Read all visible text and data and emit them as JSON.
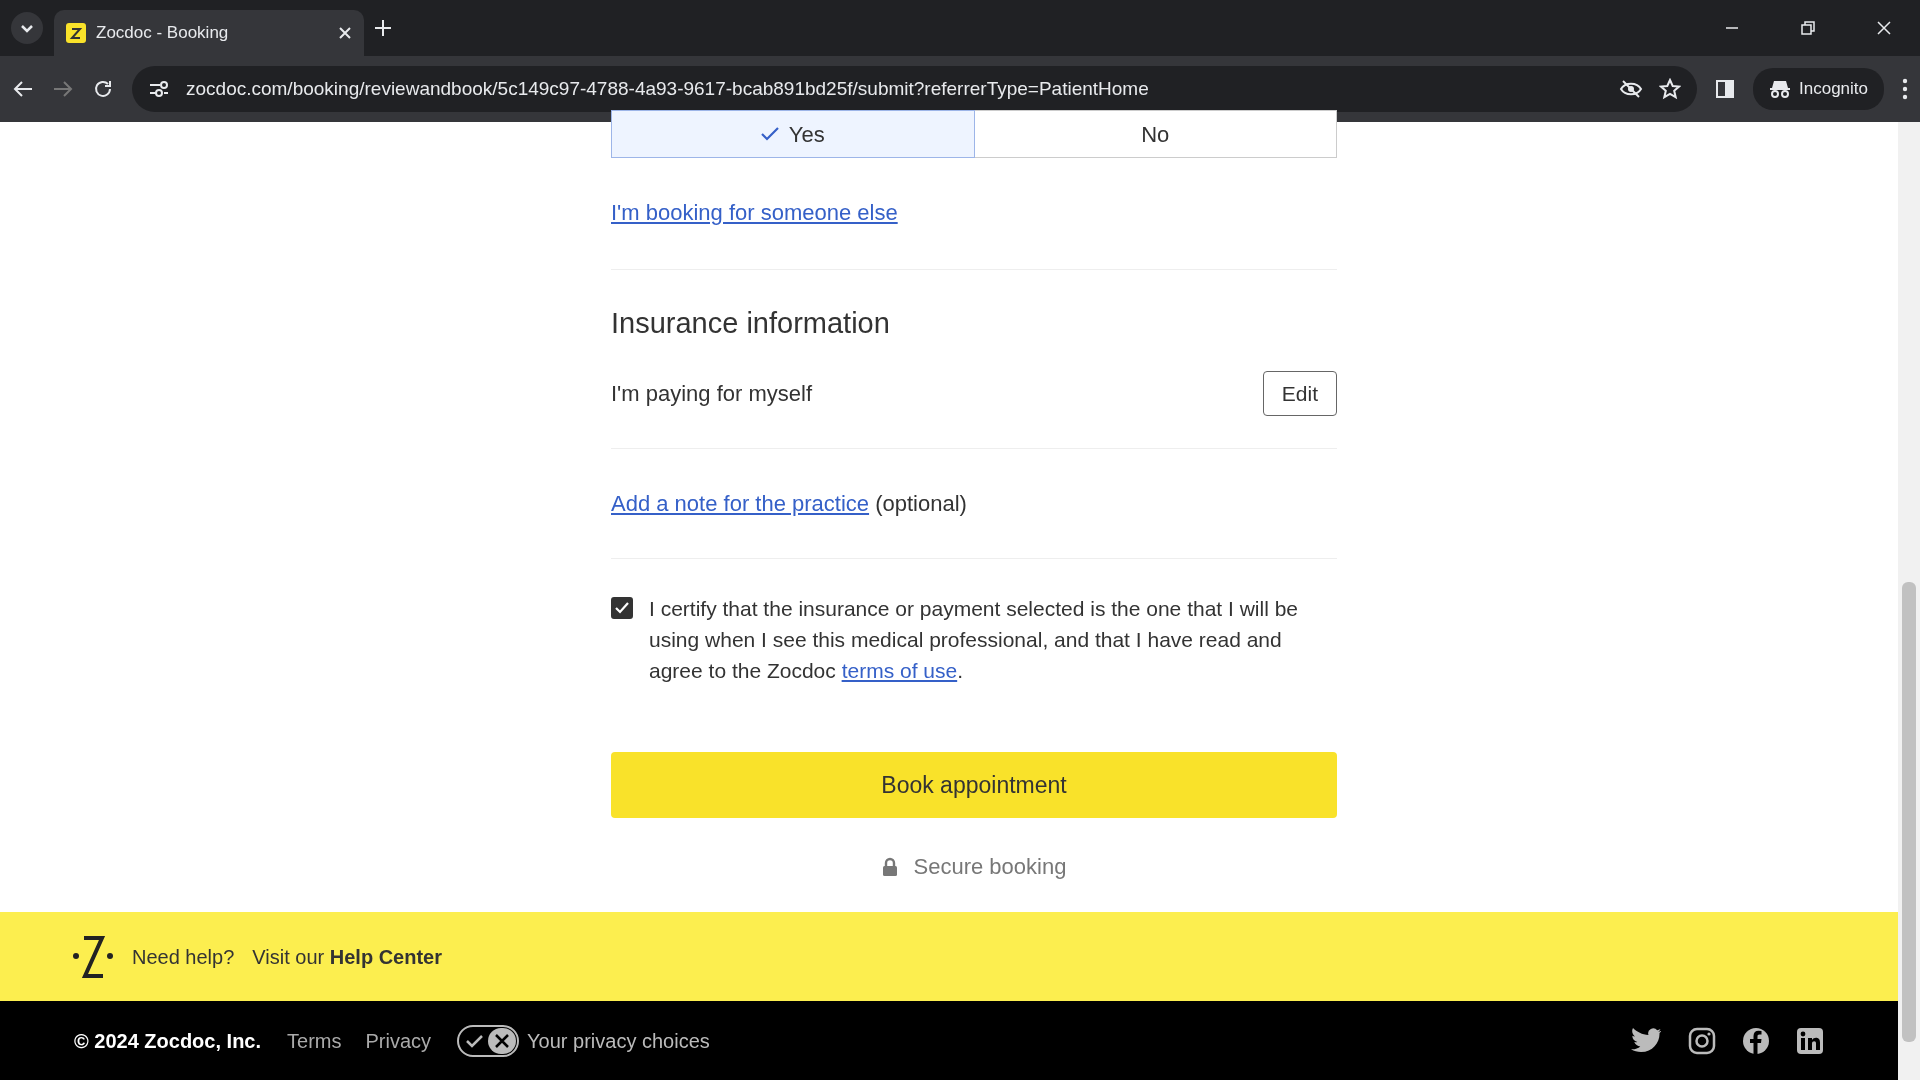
{
  "browser": {
    "tab_title": "Zocdoc - Booking",
    "url": "zocdoc.com/booking/reviewandbook/5c149c97-4788-4a93-9617-bcab891bd25f/submit?referrerType=PatientHome",
    "profile": "Incognito"
  },
  "toggle": [
    {
      "label": "Yes",
      "selected": true
    },
    {
      "label": "No",
      "selected": false
    }
  ],
  "booking_link": "I'm booking for someone else",
  "insurance": {
    "heading": "Insurance information",
    "text": "I'm paying for myself",
    "edit_button": "Edit"
  },
  "note": {
    "link": "Add a note for the practice",
    "suffix": "(optional)"
  },
  "certify": {
    "checked": true,
    "text_before": "I certify that the insurance or payment selected is the one that I will be using when I see this medical professional, and that I have read and agree to the Zocdoc ",
    "link": "terms of use",
    "text_after": "."
  },
  "book_button": "Book appointment",
  "secure": "Secure booking",
  "help": {
    "prompt": "Need help?",
    "visit": "Visit our **Help Center**"
  },
  "footer": {
    "copyright": "© 2024 Zocdoc, Inc.",
    "links": [
      "Terms",
      "Privacy"
    ],
    "privacy_choices": "Your privacy choices"
  }
}
